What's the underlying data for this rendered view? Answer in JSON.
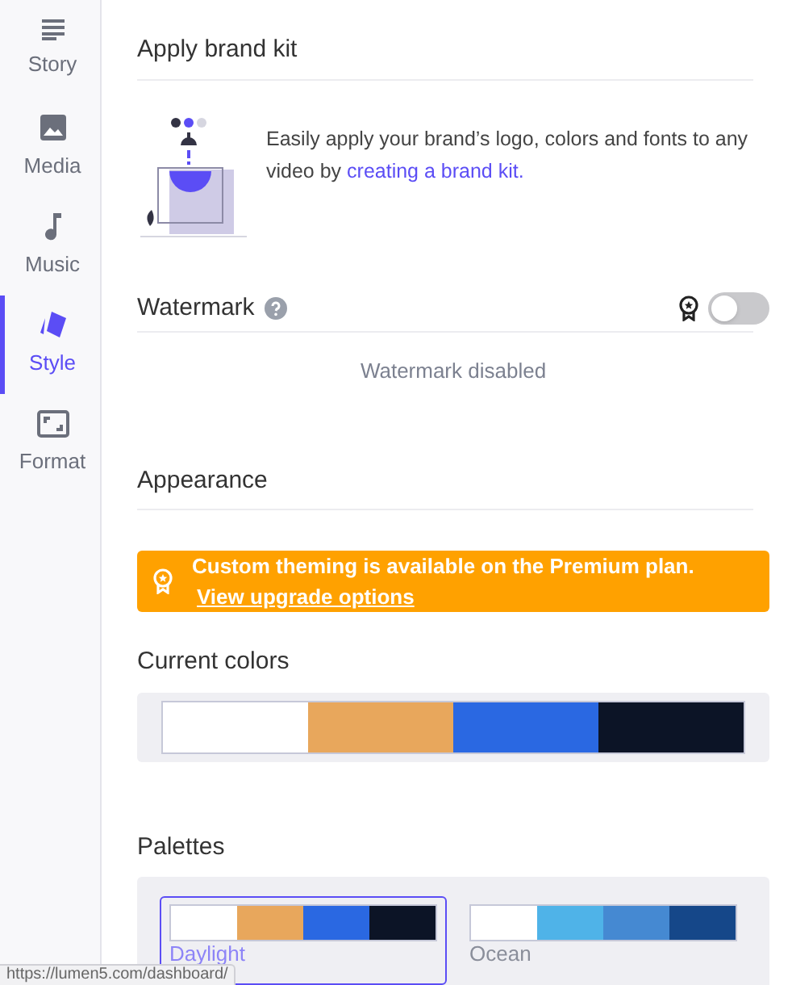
{
  "sidebar": {
    "items": [
      {
        "label": "Story",
        "selected": false
      },
      {
        "label": "Media",
        "selected": false
      },
      {
        "label": "Music",
        "selected": false
      },
      {
        "label": "Style",
        "selected": true
      },
      {
        "label": "Format",
        "selected": false
      }
    ]
  },
  "brand_kit": {
    "title": "Apply brand kit",
    "text": "Easily apply your brand’s logo, colors and fonts to any video by ",
    "link": "creating a brand kit."
  },
  "watermark": {
    "title": "Watermark",
    "on": false,
    "status": "Watermark disabled"
  },
  "appearance": {
    "title": "Appearance",
    "banner": "Custom theming is available on the Premium plan.",
    "banner_link": "View upgrade options"
  },
  "current_colors": {
    "title": "Current colors",
    "colors": [
      {
        "color": "#ffffff"
      },
      {
        "color": "#e8a75c"
      },
      {
        "color": "#2a68e2"
      },
      {
        "color": "#0c1426"
      }
    ]
  },
  "palettes": {
    "title": "Palettes",
    "items": [
      {
        "name": "Daylight",
        "selected": true,
        "colors": [
          {
            "color": "#ffffff"
          },
          {
            "color": "#e8a75c"
          },
          {
            "color": "#2a68e2"
          },
          {
            "color": "#0c1426"
          }
        ]
      },
      {
        "name": "Ocean",
        "selected": false,
        "colors": [
          {
            "color": "#ffffff"
          },
          {
            "color": "#4fb3e8"
          },
          {
            "color": "#4589d2"
          },
          {
            "color": "#154789"
          }
        ]
      }
    ]
  },
  "status_url": "https://lumen5.com/dashboard/"
}
